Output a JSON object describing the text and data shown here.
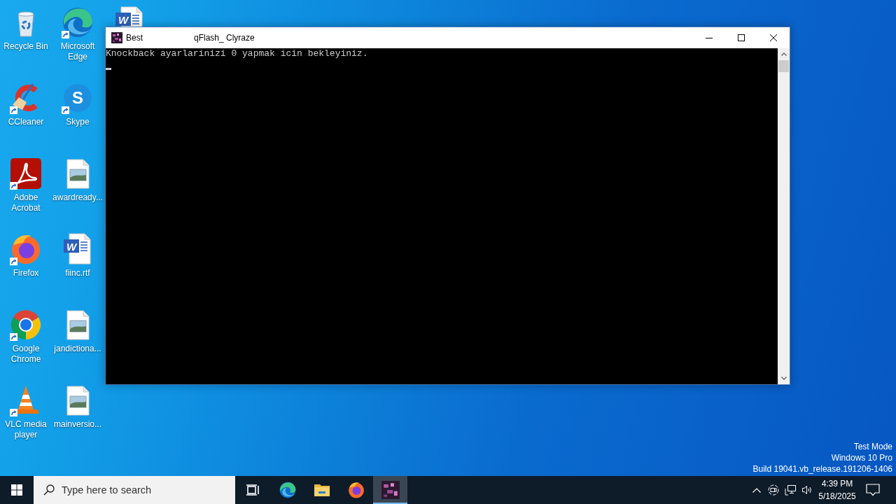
{
  "desktop": {
    "icons": [
      {
        "kind": "recycle-bin",
        "label": "Recycle Bin",
        "shortcut": false
      },
      {
        "kind": "ccleaner",
        "label": "CCleaner",
        "shortcut": true
      },
      {
        "kind": "acrobat",
        "label": "Adobe Acrobat",
        "shortcut": true
      },
      {
        "kind": "firefox",
        "label": "Firefox",
        "shortcut": true
      },
      {
        "kind": "chrome",
        "label": "Google Chrome",
        "shortcut": true
      },
      {
        "kind": "vlc",
        "label": "VLC media player",
        "shortcut": true
      },
      {
        "kind": "edge",
        "label": "Microsoft Edge",
        "shortcut": true
      },
      {
        "kind": "skype",
        "label": "Skype",
        "shortcut": true,
        "glyph": "S"
      },
      {
        "kind": "image-file",
        "label": "awardready...",
        "shortcut": false
      },
      {
        "kind": "word-file",
        "label": "fiinc.rtf",
        "shortcut": false,
        "glyph": "W"
      },
      {
        "kind": "image-file",
        "label": "jandictiona...",
        "shortcut": false
      },
      {
        "kind": "image-file",
        "label": "mainversio...",
        "shortcut": false
      },
      {
        "kind": "word-file",
        "shortcut": false,
        "glyph": "W"
      }
    ]
  },
  "window": {
    "app_name": "Best",
    "title": "qFlash_ Clyraze",
    "console_lines": [
      "Knockback ayarlarinizi 0 yapmak icin bekleyiniz."
    ]
  },
  "os_notice": [
    "Test Mode",
    "Windows 10 Pro",
    "Build 19041.vb_release.191206-1406"
  ],
  "taskbar": {
    "search": {
      "placeholder": "Type here to search"
    },
    "apps": [
      {
        "kind": "task-view",
        "selected": false
      },
      {
        "kind": "edge",
        "selected": false
      },
      {
        "kind": "explorer",
        "selected": false
      },
      {
        "kind": "firefox",
        "selected": false
      },
      {
        "kind": "console-app",
        "selected": true
      }
    ],
    "clock": {
      "time": "4:39 PM",
      "date": "5/18/2025"
    }
  }
}
